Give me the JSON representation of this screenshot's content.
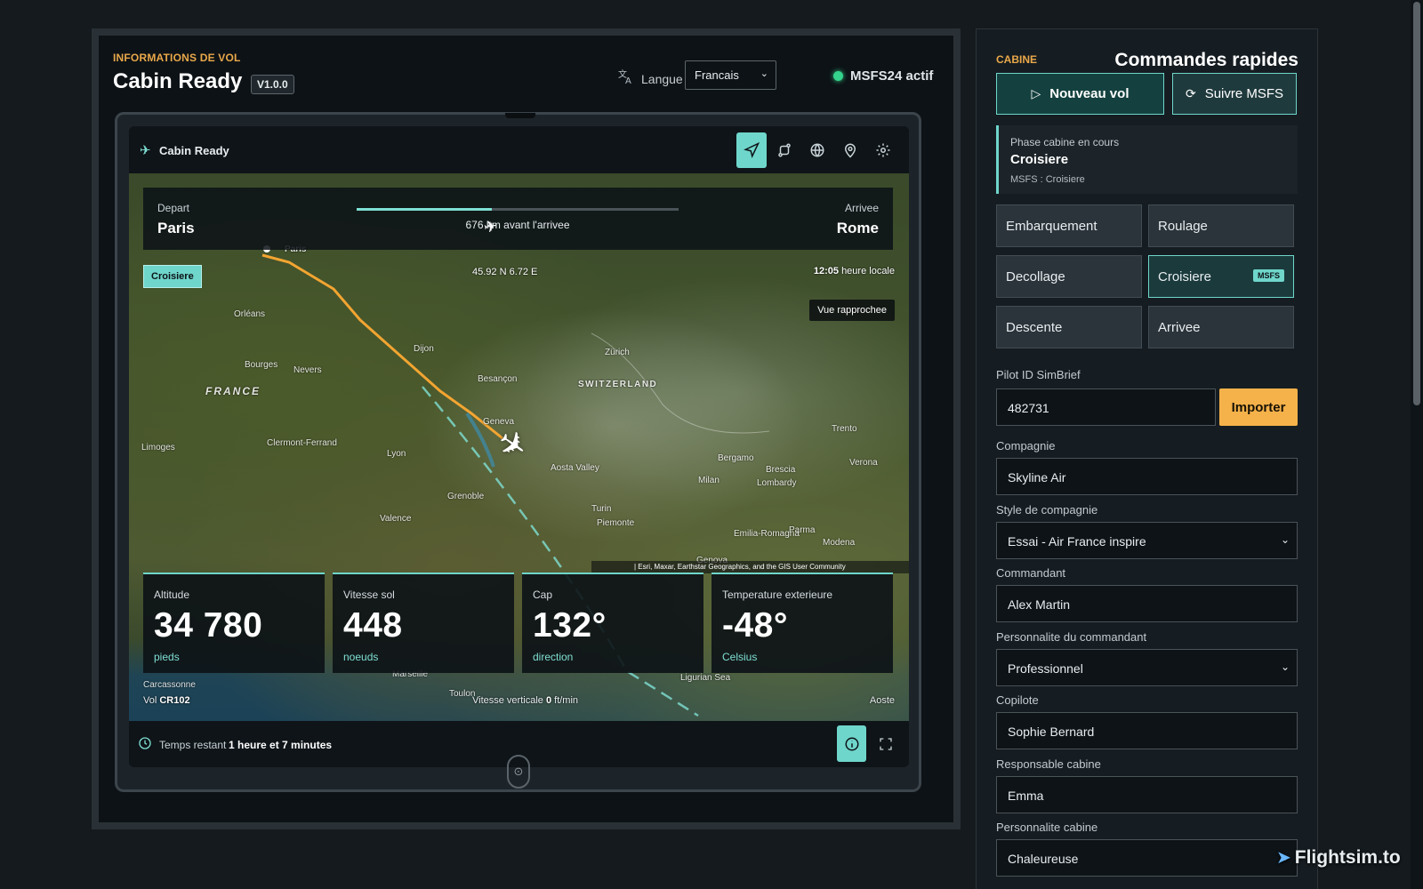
{
  "header": {
    "kicker": "INFORMATIONS DE VOL",
    "title": "Cabin Ready",
    "version": "V1.0.0",
    "language_label": "Langue",
    "language_value": "Francais",
    "sim_status": "MSFS24 actif"
  },
  "tablet": {
    "app_title": "Cabin Ready",
    "toolbar_icons": [
      "navigation-icon",
      "route-icon",
      "globe-icon",
      "map-pin-icon",
      "settings-icon"
    ],
    "route": {
      "depart_label": "Depart",
      "depart_value": "Paris",
      "arrival_label": "Arrivee",
      "arrival_value": "Rome",
      "progress": 0.42,
      "distance_text": "676 km avant l'arrivee"
    },
    "phase_pill": "Croisiere",
    "coordinates": "45.92 N 6.72 E",
    "local_time_value": "12:05",
    "local_time_suffix": "heure locale",
    "zoom_button": "Vue rapprochee",
    "attribution": "| Esri, Maxar, Earthstar Geographics, and the GIS User Community",
    "map_labels": {
      "paris": "Paris",
      "france": "FRANCE",
      "switzerland": "SWITZERLAND",
      "geneva": "Geneva",
      "lyon": "Lyon",
      "grenoble": "Grenoble",
      "turin": "Turin",
      "milan": "Milan",
      "dijon": "Dijon",
      "zurich": "Zürich",
      "marseille": "Marseille",
      "toulon": "Toulon",
      "carcassonne": "Carcassonne",
      "ligurian": "Ligurian Sea",
      "limoges": "Limoges",
      "clermont": "Clermont-Ferrand",
      "orleans": "Orléans",
      "bergamo": "Bergamo",
      "brescia": "Brescia",
      "modena": "Modena",
      "parma": "Parma",
      "genoa": "Genova",
      "piemonte": "Piemonte",
      "lombardy": "Lombardy",
      "trento": "Trento",
      "verona": "Verona",
      "aosta": "Aosta Valley",
      "valence": "Valence",
      "besancon": "Besançon",
      "bourges": "Bourges",
      "nevers": "Nevers",
      "emilia": "Emilia-Romagna"
    },
    "stats": [
      {
        "label": "Altitude",
        "value": "34 780",
        "unit": "pieds"
      },
      {
        "label": "Vitesse sol",
        "value": "448",
        "unit": "noeuds"
      },
      {
        "label": "Cap",
        "value": "132°",
        "unit": "direction"
      },
      {
        "label": "Temperature exterieure",
        "value": "-48°",
        "unit": "Celsius"
      }
    ],
    "flight_prefix": "Vol",
    "flight_number": "CR102",
    "vs_label": "Vitesse verticale",
    "vs_value": "0",
    "vs_unit": "ft/min",
    "next_waypoint": "Aoste",
    "remaining_label": "Temps restant",
    "remaining_value": "1 heure et 7 minutes"
  },
  "panel": {
    "kicker": "CABINE",
    "heading": "Commandes rapides",
    "new_flight": "Nouveau vol",
    "follow_msfs": "Suivre MSFS",
    "current_phase_label": "Phase cabine en cours",
    "current_phase_value": "Croisiere",
    "current_phase_source": "MSFS : Croisiere",
    "phases": [
      "Embarquement",
      "Roulage",
      "Decollage",
      "Croisiere",
      "Descente",
      "Arrivee"
    ],
    "msfs_badge": "MSFS",
    "pilot_id_label": "Pilot ID SimBrief",
    "pilot_id_value": "482731",
    "import_button": "Importer",
    "company_label": "Compagnie",
    "company_value": "Skyline Air",
    "style_label": "Style de compagnie",
    "style_value": "Essai - Air France inspire",
    "captain_label": "Commandant",
    "captain_value": "Alex Martin",
    "captain_personality_label": "Personnalite du commandant",
    "captain_personality_value": "Professionnel",
    "copilot_label": "Copilote",
    "copilot_value": "Sophie Bernard",
    "cabin_lead_label": "Responsable cabine",
    "cabin_lead_value": "Emma",
    "cabin_personality_label": "Personnalite cabine",
    "cabin_personality_value": "Chaleureuse"
  },
  "watermark": "Flightsim.to",
  "colors": {
    "accent": "#6fd6cb",
    "warning": "#e9a84a",
    "import": "#f5b24a",
    "status_ok": "#35d48c",
    "route_line": "#f3a531"
  }
}
